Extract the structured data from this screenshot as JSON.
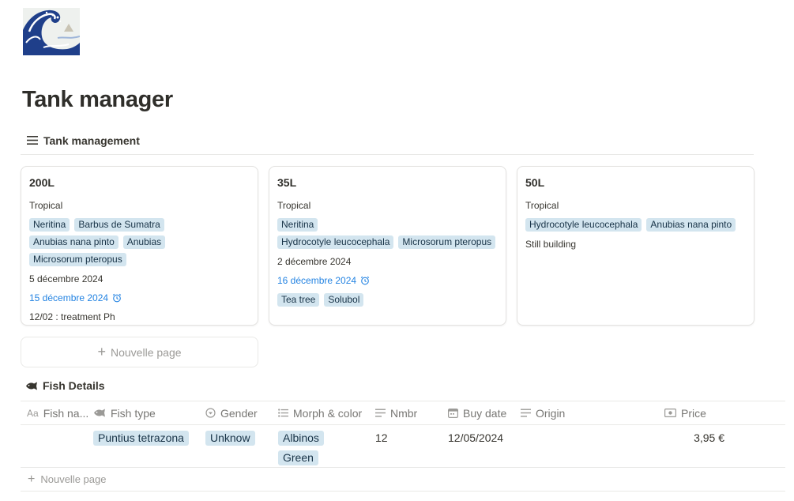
{
  "page": {
    "icon": "great-wave-icon",
    "title": "Tank manager"
  },
  "board_view": {
    "label": "Tank management",
    "icon": "list-icon",
    "cards": [
      {
        "title": "200L",
        "type": "Tropical",
        "tags": [
          "Neritina",
          "Barbus de Sumatra",
          "Anubias nana pinto",
          "Anubias",
          "Microsorum pteropus"
        ],
        "date": "5 décembre 2024",
        "reminder": "15 décembre 2024",
        "note": "12/02 : treatment Ph"
      },
      {
        "title": "35L",
        "type": "Tropical",
        "tags": [
          "Neritina",
          "Hydrocotyle leucocephala",
          "Microsorum pteropus"
        ],
        "date": "2 décembre 2024",
        "reminder": "16 décembre 2024",
        "products": [
          "Tea tree",
          "Solubol"
        ]
      },
      {
        "title": "50L",
        "type": "Tropical",
        "tags": [
          "Hydrocotyle leucocephala",
          "Anubias nana pinto"
        ],
        "status": "Still building"
      }
    ],
    "new_page_label": "Nouvelle page"
  },
  "fish_view": {
    "label": "Fish Details",
    "columns": [
      {
        "label": "Fish na...",
        "icon": "text-icon"
      },
      {
        "label": "Fish type",
        "icon": "fish-icon"
      },
      {
        "label": "Gender",
        "icon": "select-icon"
      },
      {
        "label": "Morph & color",
        "icon": "multi-select-icon"
      },
      {
        "label": "Nmbr",
        "icon": "number-icon"
      },
      {
        "label": "Buy date",
        "icon": "calendar-icon"
      },
      {
        "label": "Origin",
        "icon": "text-lines-icon"
      },
      {
        "label": "Price",
        "icon": "money-icon"
      }
    ],
    "rows": [
      {
        "fish_name": "",
        "fish_type": "Puntius tetrazona",
        "gender": "Unknow",
        "morphs": [
          "Albinos",
          "Green"
        ],
        "nmbr": "12",
        "buy_date": "12/05/2024",
        "origin": "",
        "price": "3,95 €"
      }
    ],
    "new_row_label": "Nouvelle page"
  },
  "colors": {
    "tag_bg": "#d3e5ef",
    "tag_text": "#183347",
    "reminder_blue": "#2383e2",
    "muted": "#9b9a97"
  }
}
